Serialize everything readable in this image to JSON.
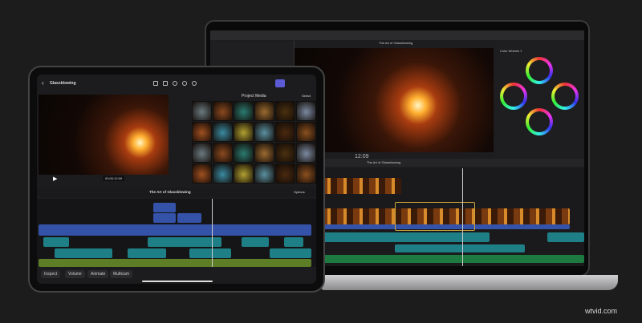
{
  "ipad": {
    "project_name": "Glassblowing",
    "media_title": "Project Media",
    "select_label": "Select",
    "timecode": "00:00:12:09",
    "timeline_title": "The Art of Glassblowing",
    "options_label": "Options",
    "bottom_toolbar": [
      "Inspect",
      "Volume",
      "Animate",
      "Multicam"
    ],
    "active_tool_color": "#5b5bd6"
  },
  "mac": {
    "viewer_title": "The Art of Glassblowing",
    "timecode": "12:09",
    "timeline_title": "The Art of Glassblowing",
    "inspector_title": "Color Wheels 1"
  },
  "watermark": "wtvid.com"
}
